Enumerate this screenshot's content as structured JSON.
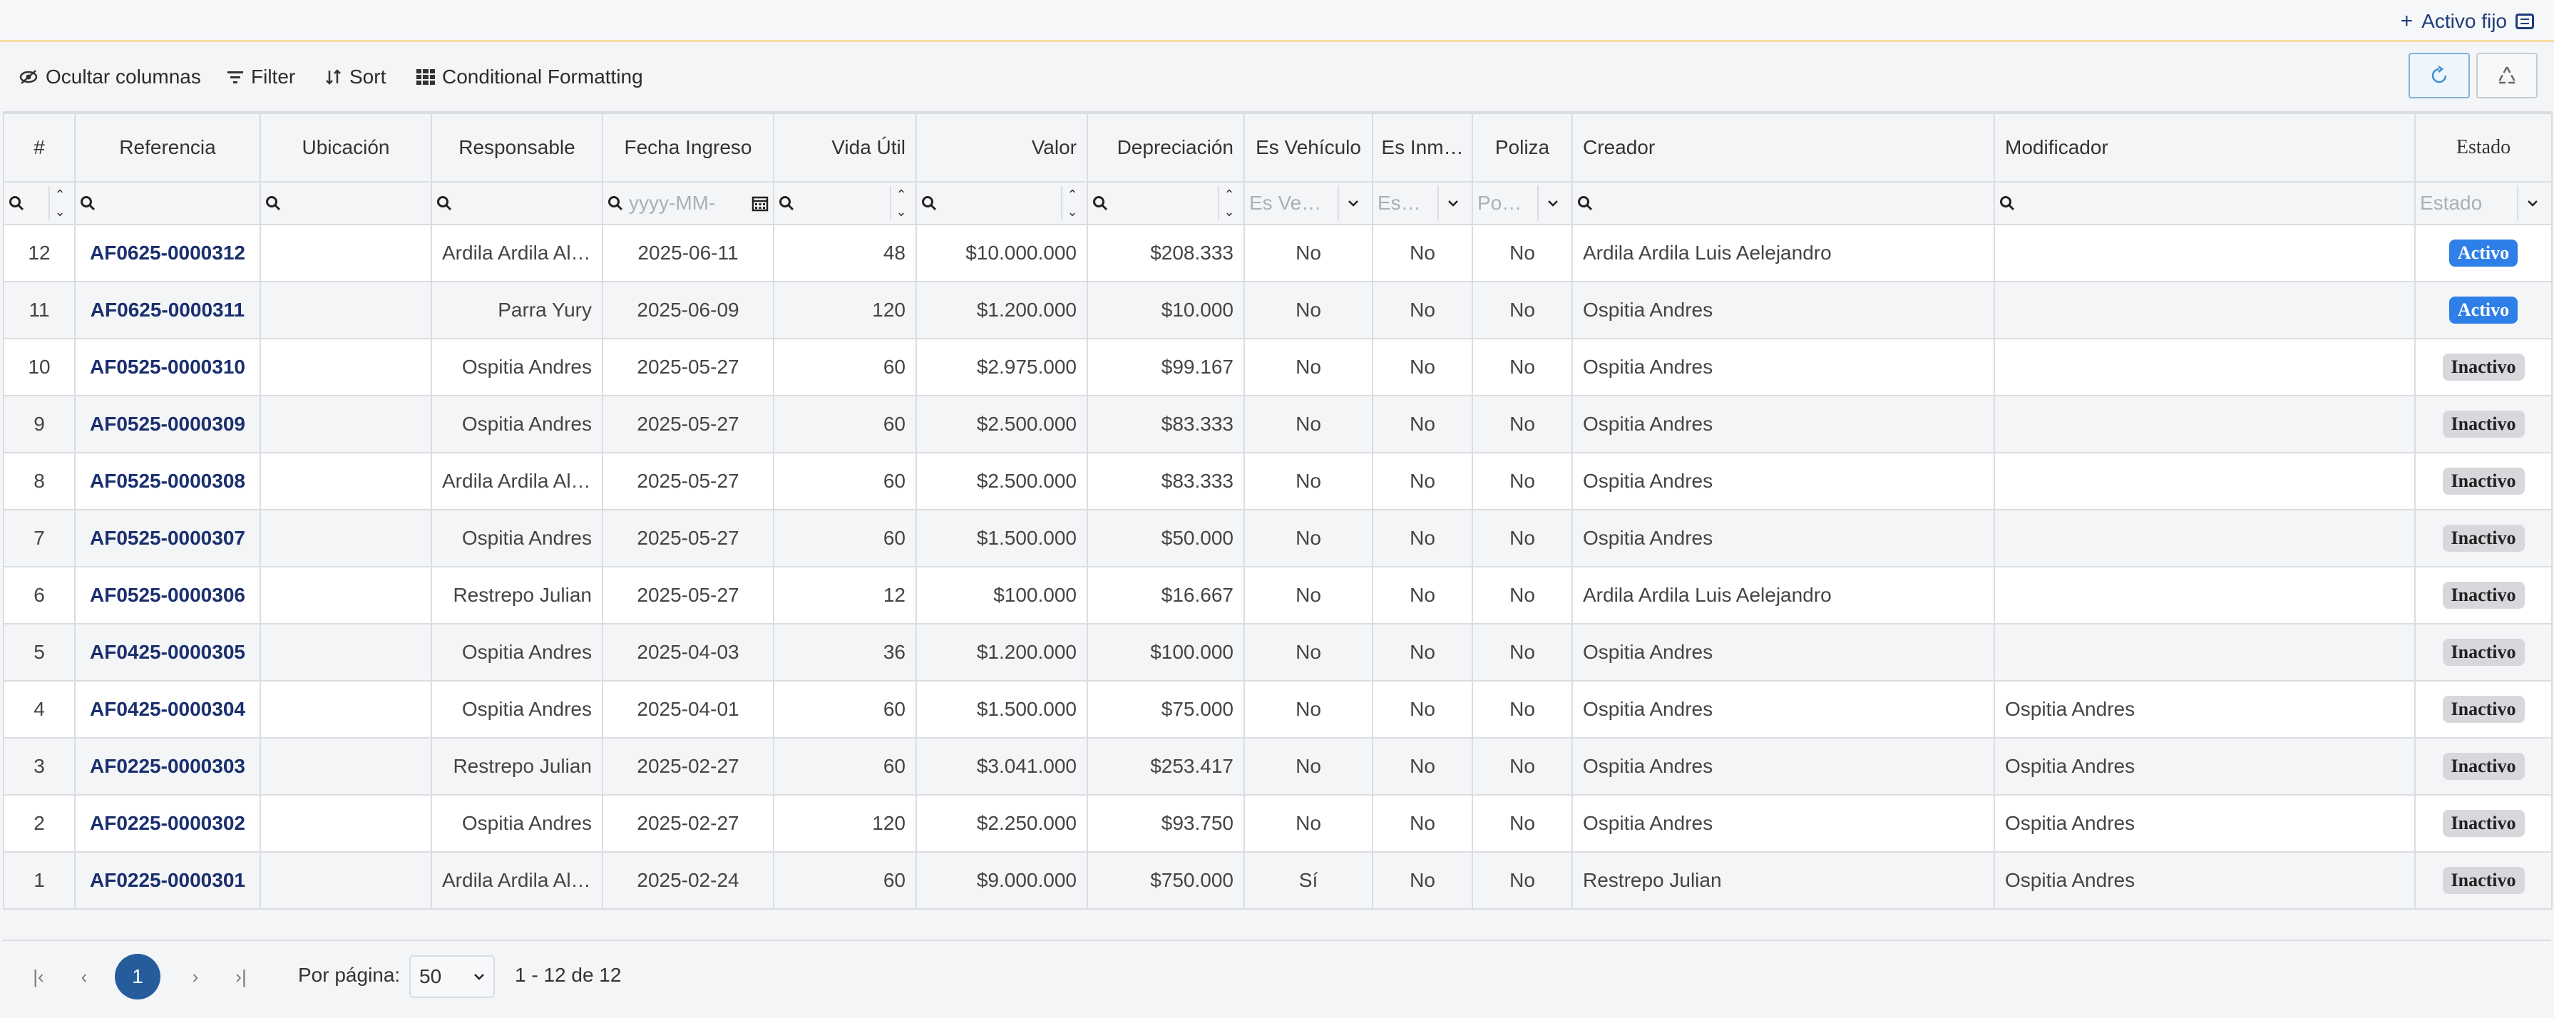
{
  "header": {
    "add_label": "Activo fijo",
    "plus": "+"
  },
  "toolbar": {
    "hide_columns": "Ocultar columnas",
    "filter": "Filter",
    "sort": "Sort",
    "conditional": "Conditional Formatting"
  },
  "columns": [
    "#",
    "Referencia",
    "Ubicación",
    "Responsable",
    "Fecha Ingreso",
    "Vida Útil",
    "Valor",
    "Depreciación",
    "Es Vehículo",
    "Es Inm…",
    "Poliza",
    "Creador",
    "Modificador",
    "Estado"
  ],
  "filters": {
    "fecha_ph": "yyyy-MM-",
    "vehiculo_ph": "Es Ve…",
    "inm_ph": "Es…",
    "poliza_ph": "Po…",
    "estado_ph": "Estado"
  },
  "rows": [
    {
      "n": "12",
      "ref": "AF0625-0000312",
      "ubic": "",
      "resp": "Ardila Ardila Alej…",
      "fecha": "2025-06-11",
      "vida": "48",
      "valor": "$10.000.000",
      "dep": "$208.333",
      "veh": "No",
      "inm": "No",
      "pol": "No",
      "creador": "Ardila Ardila Luis Aelejandro",
      "mod": "",
      "estado": "Activo",
      "activo": true
    },
    {
      "n": "11",
      "ref": "AF0625-0000311",
      "ubic": "",
      "resp": "Parra Yury",
      "fecha": "2025-06-09",
      "vida": "120",
      "valor": "$1.200.000",
      "dep": "$10.000",
      "veh": "No",
      "inm": "No",
      "pol": "No",
      "creador": "Ospitia Andres",
      "mod": "",
      "estado": "Activo",
      "activo": true
    },
    {
      "n": "10",
      "ref": "AF0525-0000310",
      "ubic": "",
      "resp": "Ospitia Andres",
      "fecha": "2025-05-27",
      "vida": "60",
      "valor": "$2.975.000",
      "dep": "$99.167",
      "veh": "No",
      "inm": "No",
      "pol": "No",
      "creador": "Ospitia Andres",
      "mod": "",
      "estado": "Inactivo",
      "activo": false
    },
    {
      "n": "9",
      "ref": "AF0525-0000309",
      "ubic": "",
      "resp": "Ospitia Andres",
      "fecha": "2025-05-27",
      "vida": "60",
      "valor": "$2.500.000",
      "dep": "$83.333",
      "veh": "No",
      "inm": "No",
      "pol": "No",
      "creador": "Ospitia Andres",
      "mod": "",
      "estado": "Inactivo",
      "activo": false
    },
    {
      "n": "8",
      "ref": "AF0525-0000308",
      "ubic": "",
      "resp": "Ardila Ardila Alej…",
      "fecha": "2025-05-27",
      "vida": "60",
      "valor": "$2.500.000",
      "dep": "$83.333",
      "veh": "No",
      "inm": "No",
      "pol": "No",
      "creador": "Ospitia Andres",
      "mod": "",
      "estado": "Inactivo",
      "activo": false
    },
    {
      "n": "7",
      "ref": "AF0525-0000307",
      "ubic": "",
      "resp": "Ospitia Andres",
      "fecha": "2025-05-27",
      "vida": "60",
      "valor": "$1.500.000",
      "dep": "$50.000",
      "veh": "No",
      "inm": "No",
      "pol": "No",
      "creador": "Ospitia Andres",
      "mod": "",
      "estado": "Inactivo",
      "activo": false
    },
    {
      "n": "6",
      "ref": "AF0525-0000306",
      "ubic": "",
      "resp": "Restrepo Julian",
      "fecha": "2025-05-27",
      "vida": "12",
      "valor": "$100.000",
      "dep": "$16.667",
      "veh": "No",
      "inm": "No",
      "pol": "No",
      "creador": "Ardila Ardila Luis Aelejandro",
      "mod": "",
      "estado": "Inactivo",
      "activo": false
    },
    {
      "n": "5",
      "ref": "AF0425-0000305",
      "ubic": "",
      "resp": "Ospitia Andres",
      "fecha": "2025-04-03",
      "vida": "36",
      "valor": "$1.200.000",
      "dep": "$100.000",
      "veh": "No",
      "inm": "No",
      "pol": "No",
      "creador": "Ospitia Andres",
      "mod": "",
      "estado": "Inactivo",
      "activo": false
    },
    {
      "n": "4",
      "ref": "AF0425-0000304",
      "ubic": "",
      "resp": "Ospitia Andres",
      "fecha": "2025-04-01",
      "vida": "60",
      "valor": "$1.500.000",
      "dep": "$75.000",
      "veh": "No",
      "inm": "No",
      "pol": "No",
      "creador": "Ospitia Andres",
      "mod": "Ospitia Andres",
      "estado": "Inactivo",
      "activo": false
    },
    {
      "n": "3",
      "ref": "AF0225-0000303",
      "ubic": "",
      "resp": "Restrepo Julian",
      "fecha": "2025-02-27",
      "vida": "60",
      "valor": "$3.041.000",
      "dep": "$253.417",
      "veh": "No",
      "inm": "No",
      "pol": "No",
      "creador": "Ospitia Andres",
      "mod": "Ospitia Andres",
      "estado": "Inactivo",
      "activo": false
    },
    {
      "n": "2",
      "ref": "AF0225-0000302",
      "ubic": "",
      "resp": "Ospitia Andres",
      "fecha": "2025-02-27",
      "vida": "120",
      "valor": "$2.250.000",
      "dep": "$93.750",
      "veh": "No",
      "inm": "No",
      "pol": "No",
      "creador": "Ospitia Andres",
      "mod": "Ospitia Andres",
      "estado": "Inactivo",
      "activo": false
    },
    {
      "n": "1",
      "ref": "AF0225-0000301",
      "ubic": "",
      "resp": "Ardila Ardila Alej…",
      "fecha": "2025-02-24",
      "vida": "60",
      "valor": "$9.000.000",
      "dep": "$750.000",
      "veh": "Sí",
      "inm": "No",
      "pol": "No",
      "creador": "Restrepo Julian",
      "mod": "Ospitia Andres",
      "estado": "Inactivo",
      "activo": false
    }
  ],
  "pagination": {
    "current_page": "1",
    "per_page_label": "Por página:",
    "per_page_value": "50",
    "range": "1 - 12 de 12",
    "first": "|‹",
    "prev": "‹",
    "next": "›",
    "last": "›|"
  },
  "colors": {
    "active_badge": "#2e7fe8",
    "inactive_badge": "#d6d8db",
    "link": "#1a2f6e",
    "page_current": "#275c9c"
  }
}
